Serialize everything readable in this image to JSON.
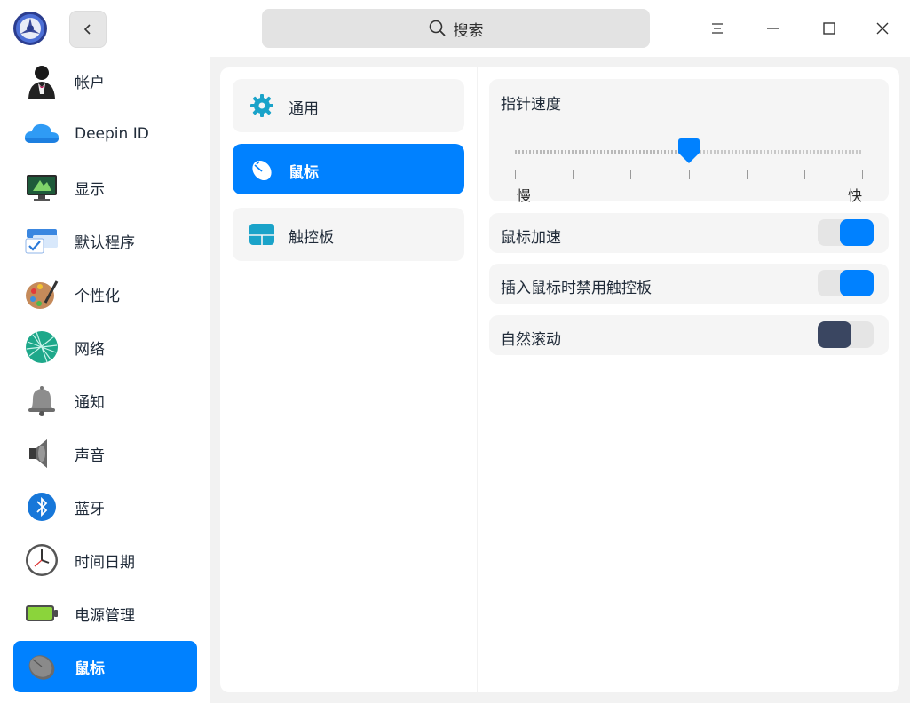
{
  "search": {
    "placeholder": "搜索"
  },
  "sidebar": {
    "items": [
      {
        "label": "帐户",
        "icon": "account-icon"
      },
      {
        "label": "Deepin ID",
        "icon": "cloud-icon"
      },
      {
        "label": "显示",
        "icon": "display-icon"
      },
      {
        "label": "默认程序",
        "icon": "default-apps-icon"
      },
      {
        "label": "个性化",
        "icon": "personalization-icon"
      },
      {
        "label": "网络",
        "icon": "network-icon"
      },
      {
        "label": "通知",
        "icon": "bell-icon"
      },
      {
        "label": "声音",
        "icon": "speaker-icon"
      },
      {
        "label": "蓝牙",
        "icon": "bluetooth-icon"
      },
      {
        "label": "时间日期",
        "icon": "clock-icon"
      },
      {
        "label": "电源管理",
        "icon": "battery-icon"
      },
      {
        "label": "鼠标",
        "icon": "mouse-icon"
      }
    ],
    "active_index": 11
  },
  "subnav": {
    "items": [
      {
        "label": "通用",
        "icon": "gear-icon"
      },
      {
        "label": "鼠标",
        "icon": "mouse-icon"
      },
      {
        "label": "触控板",
        "icon": "touchpad-icon"
      }
    ],
    "active_index": 1
  },
  "pointer_speed": {
    "label": "指针速度",
    "min_label": "慢",
    "max_label": "快",
    "value_fraction": 0.5,
    "ticks": 7
  },
  "settings": {
    "mouse_acceleration": {
      "label": "鼠标加速",
      "enabled": true
    },
    "disable_touchpad": {
      "label": "插入鼠标时禁用触控板",
      "enabled": true
    },
    "natural_scroll": {
      "label": "自然滚动",
      "enabled": false
    }
  },
  "colors": {
    "accent": "#0081ff",
    "toggle_off_knob": "#3a4661",
    "sidebar_bg": "#ffffff",
    "window_bg": "#f2f2f2"
  }
}
